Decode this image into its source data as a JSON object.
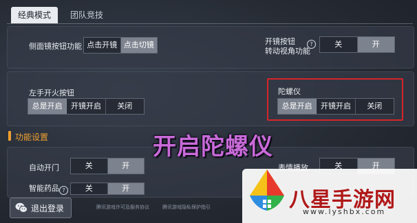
{
  "tabs": [
    {
      "label": "经典模式",
      "active": true
    },
    {
      "label": "团队竞技",
      "active": false
    }
  ],
  "side_scope": {
    "label": "侧面镜按钮功能",
    "options": [
      "点击开镜",
      "点击切镜"
    ],
    "selected": 1
  },
  "scope_rotate": {
    "label_line1": "开镜按钮",
    "label_line2": "转动视角功能",
    "help": "?",
    "options": [
      "关",
      "开"
    ],
    "selected": 1
  },
  "left_fire": {
    "label": "左手开火按钮",
    "options": [
      "总是开启",
      "开镜开启",
      "关闭"
    ],
    "selected": 0
  },
  "gyroscope": {
    "label": "陀螺仪",
    "options": [
      "总是开启",
      "开镜开启",
      "关闭"
    ],
    "selected": 0,
    "highlight_color": "#d6242a"
  },
  "overlay_title": "开启陀螺仪",
  "section": {
    "title": "功能设置",
    "accent": "#f0a030"
  },
  "auto_door": {
    "label": "自动开门",
    "options": [
      "关",
      "开"
    ],
    "selected": 1
  },
  "emote": {
    "label": "表情播放",
    "options": [
      "关",
      "开"
    ],
    "selected": 1
  },
  "smart_med": {
    "label": "智能药品",
    "help": "?",
    "options": [
      "关",
      "开"
    ],
    "selected": 1
  },
  "logout": {
    "label": "退出登录",
    "icon": "wechat-icon"
  },
  "footer": {
    "link1": "腾讯游戏许可及服务协议",
    "link2": "腾讯游戏隐私保护指引"
  },
  "watermark": {
    "text": "八星手游网",
    "url": "www.lyshbx.com",
    "color": "#b01818"
  }
}
